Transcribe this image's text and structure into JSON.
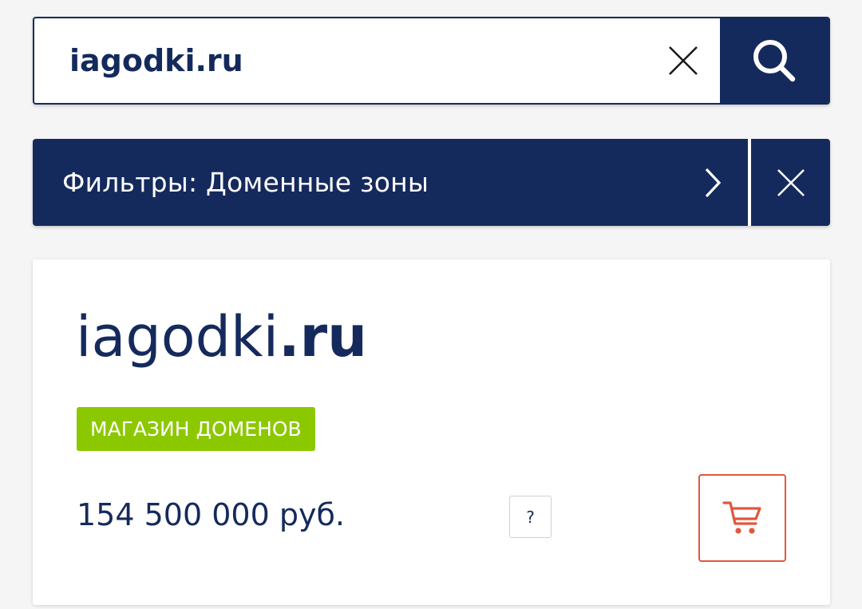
{
  "search": {
    "value": "iagodki.ru",
    "clear_icon": "close-icon",
    "submit_icon": "search-icon"
  },
  "filter": {
    "label": "Фильтры: Доменные зоны",
    "open_icon": "chevron-right-icon",
    "close_icon": "close-icon"
  },
  "result": {
    "domain_name": "iagodki",
    "domain_tld": ".ru",
    "badge": "МАГАЗИН ДОМЕНОВ",
    "price": "154 500 000 руб.",
    "help_label": "?",
    "cart_icon": "cart-icon"
  },
  "colors": {
    "navy": "#152a5c",
    "badge_green": "#8cc800",
    "cart_red": "#e2573d",
    "background": "#f5f5f5"
  }
}
